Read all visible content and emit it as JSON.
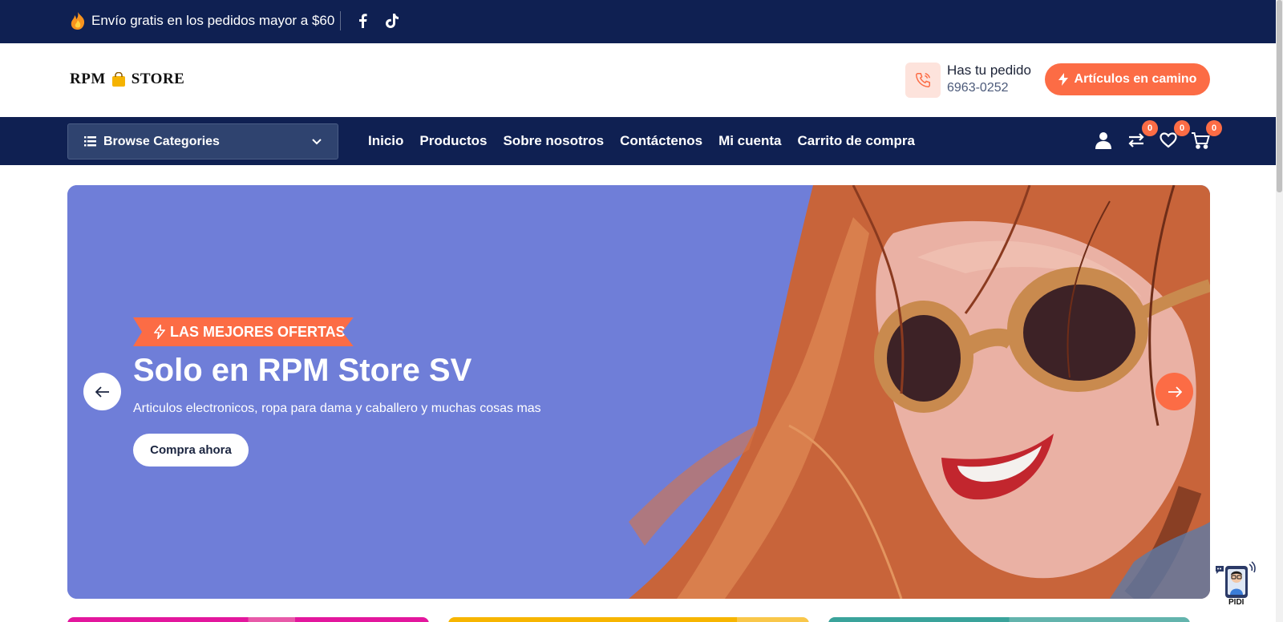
{
  "topbar": {
    "promo_text": "Envío gratis en los pedidos mayor a $60",
    "social": [
      "facebook-icon",
      "tiktok-icon"
    ]
  },
  "header": {
    "logo_text_1": "RPM",
    "logo_text_2": "STORE",
    "phone_label": "Has tu pedido",
    "phone_number": "6963-0252",
    "cta_label": "Artículos en camino"
  },
  "nav": {
    "browse_label": "Browse Categories",
    "menu": [
      "Inicio",
      "Productos",
      "Sobre nosotros",
      "Contáctenos",
      "Mi cuenta",
      "Carrito de compra"
    ],
    "compare_count": "0",
    "wishlist_count": "0",
    "cart_count": "0"
  },
  "hero": {
    "tag": "LAS MEJORES OFERTAS",
    "title": "Solo en RPM Store SV",
    "subtitle": "Articulos electronicos, ropa para dama y caballero y muchas cosas mas",
    "button": "Compra ahora"
  },
  "chatbot": {
    "label": "PIDI"
  },
  "colors": {
    "navy": "#0f2052",
    "accent": "#fc6c45",
    "hero_bg": "#6f7ed8"
  }
}
